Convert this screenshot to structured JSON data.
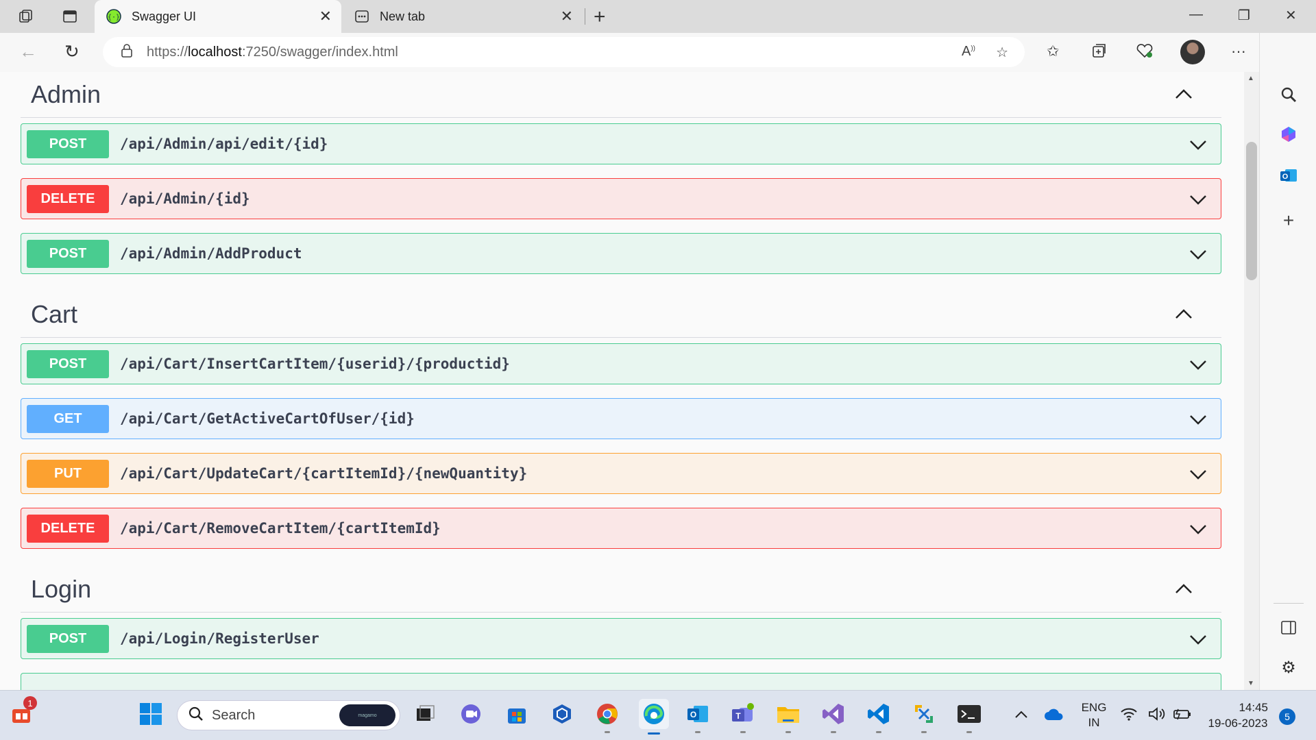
{
  "browser": {
    "tabs": [
      {
        "title": "Swagger UI",
        "active": true,
        "icon": "swagger-icon"
      },
      {
        "title": "New tab",
        "active": false,
        "icon": "new-tab-page-icon"
      }
    ],
    "url": {
      "scheme": "https://",
      "host": "localhost",
      "rest": ":7250/swagger/index.html"
    }
  },
  "sections": [
    {
      "title": "Admin",
      "operations": [
        {
          "method": "POST",
          "path": "/api/Admin/api/edit/{id}"
        },
        {
          "method": "DELETE",
          "path": "/api/Admin/{id}"
        },
        {
          "method": "POST",
          "path": "/api/Admin/AddProduct"
        }
      ]
    },
    {
      "title": "Cart",
      "operations": [
        {
          "method": "POST",
          "path": "/api/Cart/InsertCartItem/{userid}/{productid}"
        },
        {
          "method": "GET",
          "path": "/api/Cart/GetActiveCartOfUser/{id}"
        },
        {
          "method": "PUT",
          "path": "/api/Cart/UpdateCart/{cartItemId}/{newQuantity}"
        },
        {
          "method": "DELETE",
          "path": "/api/Cart/RemoveCartItem/{cartItemId}"
        }
      ]
    },
    {
      "title": "Login",
      "operations": [
        {
          "method": "POST",
          "path": "/api/Login/RegisterUser"
        }
      ]
    }
  ],
  "taskbar": {
    "search_label": "Search",
    "search_pill_text": "magamo",
    "widgets_badge": "1",
    "lang_line1": "ENG",
    "lang_line2": "IN",
    "time": "14:45",
    "date": "19-06-2023",
    "notification_count": "5"
  },
  "colors": {
    "post": "#49cc90",
    "delete": "#f93e3e",
    "get": "#61affe",
    "put": "#fca130"
  }
}
